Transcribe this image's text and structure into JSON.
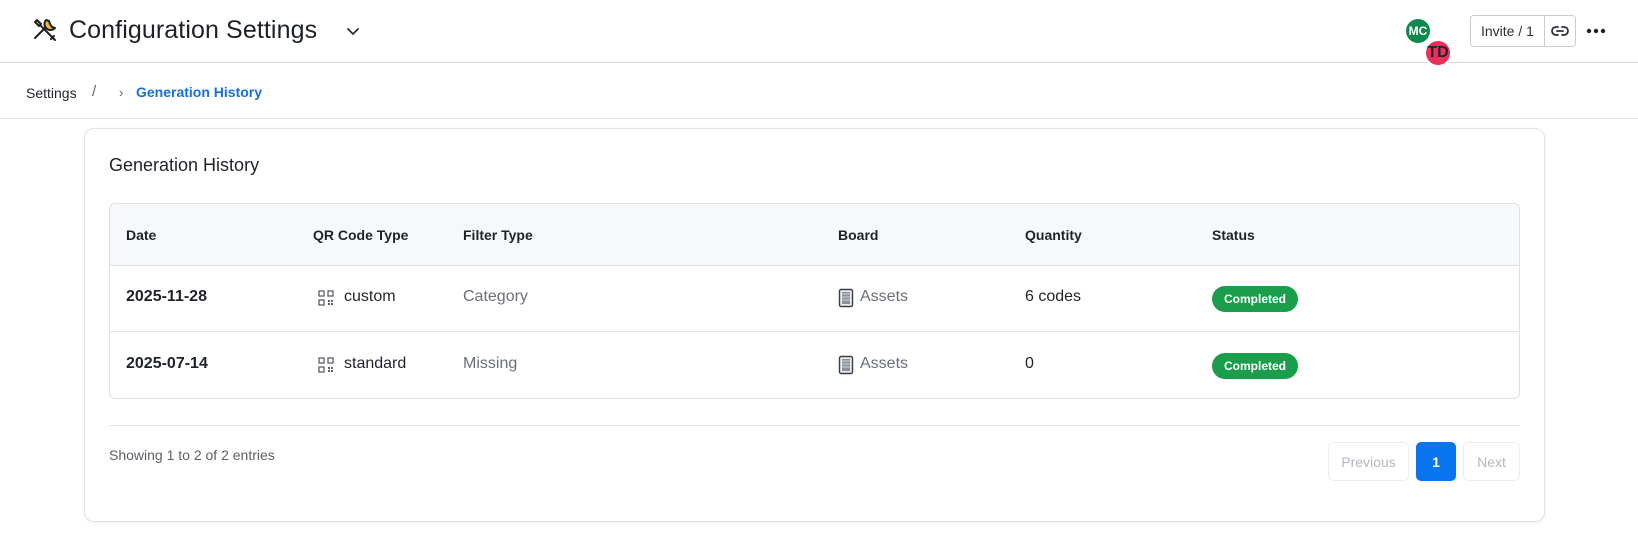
{
  "header": {
    "app_icon": "tools-icon",
    "title": "Configuration Settings",
    "avatars": [
      {
        "initials": "MC",
        "color": "#0f8a4f"
      },
      {
        "initials": "TD",
        "color": "#e8305a"
      }
    ],
    "invite_label": "Invite / 1"
  },
  "breadcrumb": {
    "root": "Settings",
    "slash": "/",
    "separator": "›",
    "current": "Generation History"
  },
  "card": {
    "title": "Generation History",
    "columns": [
      "Date",
      "QR Code Type",
      "Filter Type",
      "Board",
      "Quantity",
      "Status"
    ],
    "rows": [
      {
        "date": "2025-11-28",
        "qr_type": "custom",
        "filter_type": "Category",
        "board": "Assets",
        "quantity": "6 codes",
        "status": "Completed"
      },
      {
        "date": "2025-07-14",
        "qr_type": "standard",
        "filter_type": "Missing",
        "board": "Assets",
        "quantity": "0",
        "status": "Completed"
      }
    ],
    "footer_text": "Showing 1 to 2 of 2 entries",
    "pagination": {
      "previous": "Previous",
      "current": "1",
      "next": "Next"
    }
  },
  "colors": {
    "accent": "#0b75f0",
    "link": "#1570d8",
    "status_completed": "#1a9e4b"
  }
}
